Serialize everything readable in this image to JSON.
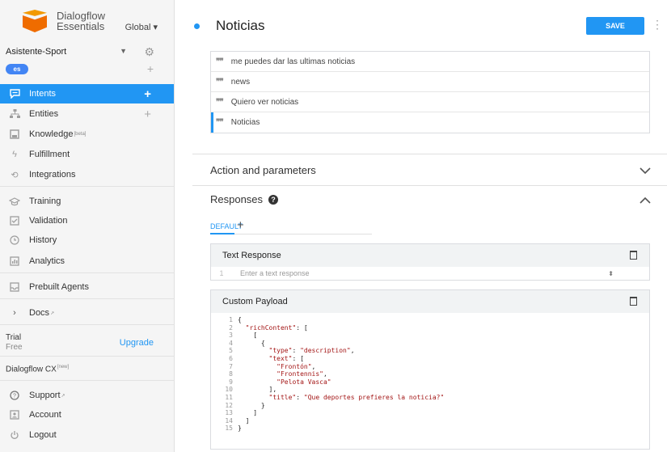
{
  "brand": {
    "line1": "Dialogflow",
    "line2": "Essentials",
    "region": "Global ▾"
  },
  "agent": {
    "name": "Asistente-Sport",
    "language": "es"
  },
  "nav": {
    "intents": "Intents",
    "entities": "Entities",
    "knowledge": "Knowledge",
    "knowledge_badge": "[beta]",
    "fulfillment": "Fulfillment",
    "integrations": "Integrations",
    "training": "Training",
    "validation": "Validation",
    "history": "History",
    "analytics": "Analytics",
    "prebuilt": "Prebuilt Agents",
    "docs": "Docs",
    "trial": "Trial",
    "trial_plan": "Free",
    "upgrade": "Upgrade",
    "cx": "Dialogflow CX",
    "cx_badge": "[new]",
    "support": "Support",
    "account": "Account",
    "logout": "Logout"
  },
  "header": {
    "title": "Noticias",
    "save": "SAVE"
  },
  "training_phrases": [
    "me puedes dar las ultimas noticias",
    "news",
    "Quiero ver noticias",
    "Noticias"
  ],
  "sections": {
    "action_params": "Action and parameters",
    "responses": "Responses"
  },
  "responses": {
    "tab_default": "DEFAULT",
    "text_response_title": "Text Response",
    "text_row_number": "1",
    "text_placeholder": "Enter a text response",
    "custom_payload_title": "Custom Payload"
  },
  "payload_lines": [
    "{",
    "  \"richContent\": [",
    "    [",
    "      {",
    "        \"type\": \"description\",",
    "        \"text\": [",
    "          \"Frontón\",",
    "          \"Frontennis\",",
    "          \"Pelota Vasca\"",
    "        ],",
    "        \"title\": \"Que deportes prefieres la noticia?\"",
    "      }",
    "    ]",
    "  ]",
    "}"
  ],
  "colors": {
    "accent": "#2196f3",
    "logo_orange": "#ef6c00"
  }
}
